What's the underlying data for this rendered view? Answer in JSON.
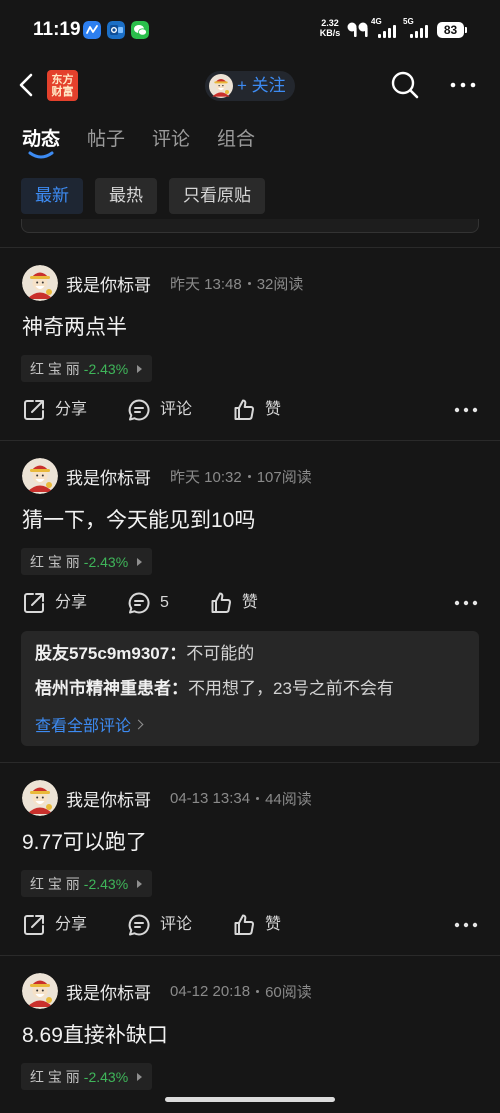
{
  "colors": {
    "background": "#161616",
    "text": "#ececec",
    "muted": "#8a8a8a",
    "accent_blue": "#3d8bf2",
    "stock_down_green": "#3fb65a",
    "logo_red": "#e4412c"
  },
  "status_bar": {
    "time": "11:19",
    "app_icons": [
      "app-icon",
      "outlook-icon",
      "wechat-icon"
    ],
    "speed_value": "2.32",
    "speed_unit": "KB/s",
    "network_1": "4G",
    "network_2": "5G",
    "battery": "83",
    "icons": [
      "earbuds-icon",
      "signal-icon",
      "signal-icon",
      "battery-icon"
    ]
  },
  "header": {
    "logo_line_1": "东方",
    "logo_line_2": "财富",
    "follow_label": "+ 关注",
    "icons": {
      "back": "back-arrow-icon",
      "search": "search-icon",
      "more": "more-icon"
    }
  },
  "tabs": [
    {
      "label": "动态",
      "active": true
    },
    {
      "label": "帖子",
      "active": false
    },
    {
      "label": "评论",
      "active": false
    },
    {
      "label": "组合",
      "active": false
    }
  ],
  "filters": [
    {
      "label": "最新",
      "active": true
    },
    {
      "label": "最热",
      "active": false
    },
    {
      "label": "只看原贴",
      "active": false
    }
  ],
  "posts": [
    {
      "author": "我是你标哥",
      "time": "昨天 13:48",
      "reads": "32阅读",
      "content": "神奇两点半",
      "stock": {
        "name": "红 宝 丽",
        "change": "-2.43%"
      },
      "actions": {
        "share": "分享",
        "comment": "评论",
        "like": "赞"
      }
    },
    {
      "author": "我是你标哥",
      "time": "昨天 10:32",
      "reads": "107阅读",
      "content": "猜一下，今天能见到10吗",
      "stock": {
        "name": "红 宝 丽",
        "change": "-2.43%"
      },
      "actions": {
        "share": "分享",
        "comment": "5",
        "like": "赞"
      },
      "comments": [
        {
          "user": "股友575c9m9307：",
          "text": "不可能的"
        },
        {
          "user": "梧州市精神重患者：",
          "text": "不用想了，23号之前不会有"
        }
      ],
      "view_all": "查看全部评论"
    },
    {
      "author": "我是你标哥",
      "time": "04-13 13:34",
      "reads": "44阅读",
      "content": "9.77可以跑了",
      "stock": {
        "name": "红 宝 丽",
        "change": "-2.43%"
      },
      "actions": {
        "share": "分享",
        "comment": "评论",
        "like": "赞"
      }
    },
    {
      "author": "我是你标哥",
      "time": "04-12 20:18",
      "reads": "60阅读",
      "content": "8.69直接补缺口",
      "stock": {
        "name": "红 宝 丽",
        "change": "-2.43%"
      }
    }
  ]
}
